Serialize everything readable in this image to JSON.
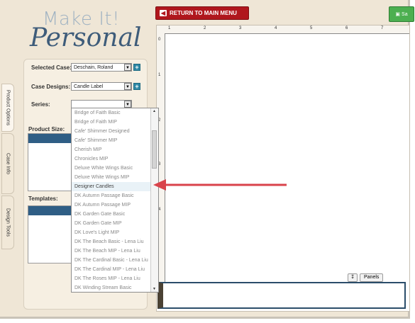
{
  "logo": {
    "line1": "Make It!",
    "line2": "Personal"
  },
  "toolbar": {
    "return_label": "RETURN TO MAIN MENU",
    "save_label": "Sa"
  },
  "form": {
    "selected_case_label": "Selected Case:",
    "selected_case_value": "Deschain, Roland",
    "case_designs_label": "Case Designs:",
    "case_designs_value": "Candle Label",
    "series_label": "Series:",
    "series_value": "",
    "product_size_label": "Product Size:",
    "templates_label": "Templates:"
  },
  "tabs": [
    "Product Options",
    "Case Info",
    "Design Tools"
  ],
  "series_dropdown": {
    "items": [
      "Bridge of Faith Basic",
      "Bridge of Faith MIP",
      "Cafe' Shimmer Designed",
      "Cafe' Shimmer MIP",
      "Cherish MIP",
      "Chronicles MIP",
      "Deluxe White Wings Basic",
      "Deluxe White Wings MIP",
      "Designer Candles",
      "DK Autumn Passage Basic",
      "DK Autumn Passage MIP",
      "DK Garden Gate Basic",
      "DK Garden Gate MIP",
      "DK Love's Light MIP",
      "DK The Beach Basic - Lena Liu",
      "DK The Beach MIP - Lena Liu",
      "DK The Cardinal Basic - Lena Liu",
      "DK The Cardinal MIP - Lena Liu",
      "DK The Roses MIP - Lena Liu",
      "DK Winding Stream Basic"
    ],
    "highlighted": "Designer Candles"
  },
  "ruler": {
    "top_numbers": [
      "1",
      "2",
      "3",
      "4",
      "5",
      "6",
      "7"
    ],
    "left_numbers": [
      "0",
      "1",
      "2",
      "3",
      "4"
    ]
  },
  "panels_label": "Panels",
  "colors": {
    "accent_red": "#b0171d",
    "arrow": "#d9434b",
    "strip_border": "#2b4d6a",
    "logo_blue": "#3e5c7a"
  }
}
